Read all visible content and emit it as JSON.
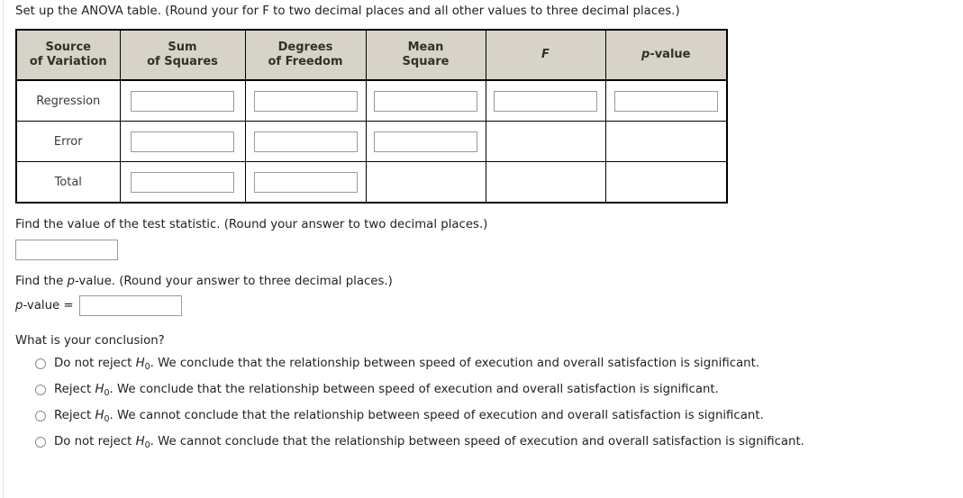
{
  "prompt": "Set up the ANOVA table. (Round your for F to two decimal places and all other values to three decimal places.)",
  "anova_table": {
    "headers": [
      {
        "line1": "Source",
        "line2": "of Variation"
      },
      {
        "line1": "Sum",
        "line2": "of Squares"
      },
      {
        "line1": "Degrees",
        "line2": "of Freedom"
      },
      {
        "line1": "Mean",
        "line2": "Square"
      },
      {
        "line1": "F",
        "line2": ""
      },
      {
        "line1": "p-value",
        "line2": ""
      }
    ],
    "rows": [
      {
        "label": "Regression",
        "inputs": [
          {
            "value": "",
            "placeholder": ""
          },
          {
            "value": "",
            "placeholder": ""
          },
          {
            "value": "",
            "placeholder": ""
          },
          {
            "value": "",
            "placeholder": ""
          },
          {
            "value": "",
            "placeholder": ""
          }
        ]
      },
      {
        "label": "Error",
        "inputs": [
          {
            "value": "",
            "placeholder": ""
          },
          {
            "value": "",
            "placeholder": ""
          },
          {
            "value": "",
            "placeholder": ""
          }
        ]
      },
      {
        "label": "Total",
        "inputs": [
          {
            "value": "",
            "placeholder": ""
          },
          {
            "value": "",
            "placeholder": ""
          }
        ]
      }
    ]
  },
  "test_statistic": {
    "prompt": "Find the value of the test statistic. (Round your answer to two decimal places.)",
    "value": "",
    "placeholder": ""
  },
  "p_value": {
    "prompt_prefix": "Find the ",
    "prompt_p": "p",
    "prompt_suffix": "-value. (Round your answer to three decimal places.)",
    "label_p": "p",
    "label_suffix": "-value =",
    "value": "",
    "placeholder": ""
  },
  "conclusion": {
    "question": "What is your conclusion?",
    "options": [
      {
        "decision": "Do not reject ",
        "hypothesis": "H",
        "subscript": "0",
        "statement": ". We conclude that the relationship between speed of execution and overall satisfaction is significant.",
        "selected": false
      },
      {
        "decision": "Reject ",
        "hypothesis": "H",
        "subscript": "0",
        "statement": ". We conclude that the relationship between speed of execution and overall satisfaction is significant.",
        "selected": false
      },
      {
        "decision": "Reject ",
        "hypothesis": "H",
        "subscript": "0",
        "statement": ". We cannot conclude that the relationship between speed of execution and overall satisfaction is significant.",
        "selected": false
      },
      {
        "decision": "Do not reject ",
        "hypothesis": "H",
        "subscript": "0",
        "statement": ". We cannot conclude that the relationship between speed of execution and overall satisfaction is significant.",
        "selected": false
      }
    ]
  },
  "colors": {
    "header_bg": "#d7d3c9",
    "table_border": "#000000",
    "input_border": "#9a9a9a",
    "text": "#222222"
  }
}
